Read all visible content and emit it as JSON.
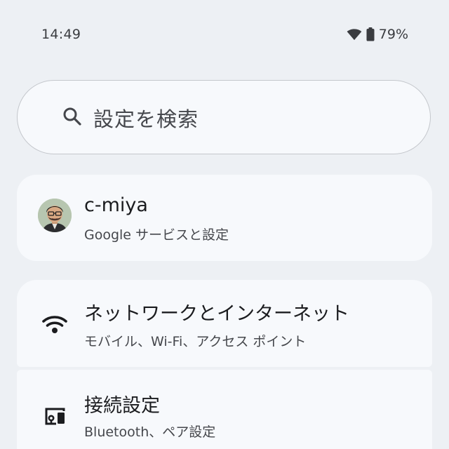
{
  "status_bar": {
    "time": "14:49",
    "battery": "79%",
    "wifi_icon": "wifi-icon",
    "battery_icon": "battery-icon"
  },
  "search": {
    "placeholder": "設定を検索",
    "icon": "search-icon"
  },
  "account": {
    "name": "c-miya",
    "subtitle": "Google サービスと設定"
  },
  "settings_items": [
    {
      "title": "ネットワークとインターネット",
      "subtitle": "モバイル、Wi-Fi、アクセス ポイント",
      "icon": "wifi-icon"
    },
    {
      "title": "接続設定",
      "subtitle": "Bluetooth、ペア設定",
      "icon": "connected-devices-icon"
    }
  ],
  "colors": {
    "background": "#edf0f4",
    "card": "#f7f9fc",
    "text_primary": "#1b1c1f",
    "text_secondary": "#45474c"
  }
}
